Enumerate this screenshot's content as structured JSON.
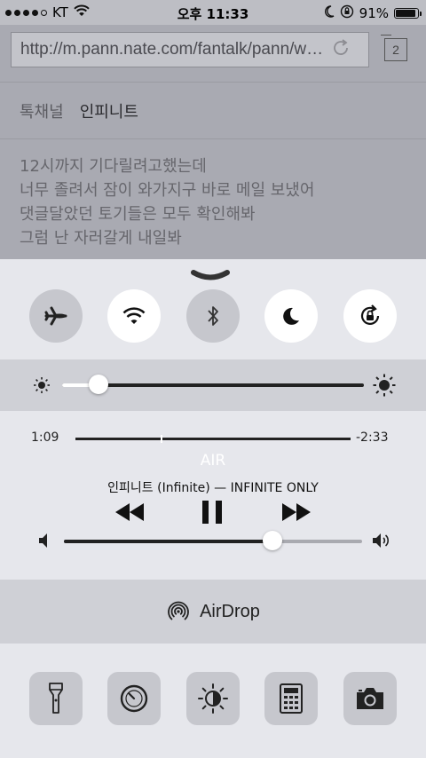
{
  "status_bar": {
    "carrier": "KT",
    "time": "오후 11:33",
    "battery_percent": "91%",
    "battery_level": 0.91,
    "signal_bars": 4,
    "icons": [
      "wifi-icon",
      "moon-icon",
      "rotation-lock-icon",
      "battery-icon"
    ]
  },
  "browser": {
    "url": "http://m.pann.nate.com/fantalk/pann/w…",
    "tab_count": "2",
    "breadcrumb": {
      "section": "톡채널",
      "current": "인피니트"
    },
    "post_lines": [
      "12시까지 기다릴려고했는데",
      "너무 졸려서 잠이 와가지구 바로 메일 보냈어",
      "댓글달았던 토기들은 모두 확인해봐",
      "그럼 난 자러갈게 내일봐"
    ]
  },
  "control_center": {
    "toggles": [
      {
        "name": "airplane-mode",
        "icon": "airplane-icon",
        "on": false
      },
      {
        "name": "wifi",
        "icon": "wifi-icon",
        "on": true
      },
      {
        "name": "bluetooth",
        "icon": "bluetooth-icon",
        "on": false
      },
      {
        "name": "do-not-disturb",
        "icon": "moon-icon",
        "on": true
      },
      {
        "name": "rotation-lock",
        "icon": "rotation-lock-icon",
        "on": true
      }
    ],
    "brightness": {
      "level": 0.12
    },
    "media": {
      "elapsed": "1:09",
      "remaining": "-2:33",
      "progress": 0.31,
      "song": "AIR",
      "artist_album": "인피니트 (Infinite) — INFINITE ONLY",
      "volume": 0.7,
      "controls": [
        "rewind-icon",
        "pause-icon",
        "fast-forward-icon"
      ]
    },
    "airdrop_label": "AirDrop",
    "shortcuts": [
      "flashlight-icon",
      "timer-icon",
      "night-shift-icon",
      "calculator-icon",
      "camera-icon"
    ],
    "colors": {
      "panel": "#e6e7ec",
      "panel_dark": "#cfd0d6",
      "button_off": "#c6c7cd",
      "button_on": "#ffffff"
    }
  }
}
